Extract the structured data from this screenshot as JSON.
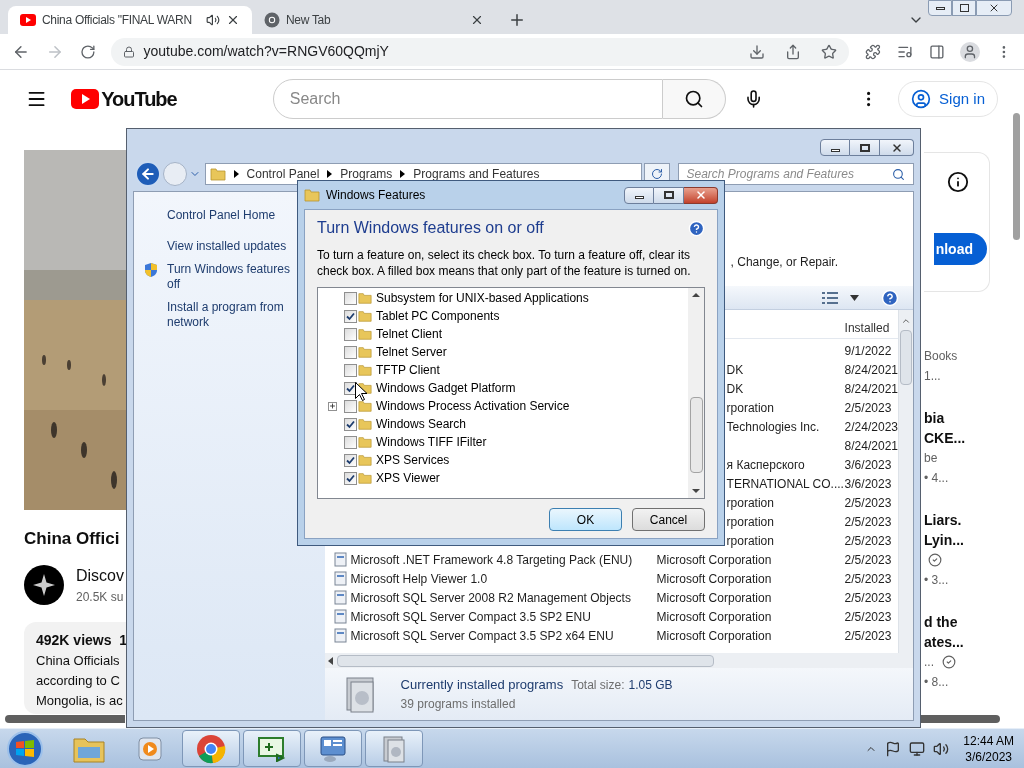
{
  "browser": {
    "tabs": [
      {
        "title": "China Officials \"FINAL WARN",
        "kind": "youtube",
        "audio": true,
        "selected": true
      },
      {
        "title": "New Tab",
        "kind": "chrome",
        "audio": false,
        "selected": false
      }
    ],
    "address": "youtube.com/watch?v=RNGV60QQmjY"
  },
  "youtube": {
    "logo": "YouTube",
    "search_placeholder": "Search",
    "sign_in": "Sign in",
    "video_title": "China Offici",
    "channel": "Discov",
    "subscribers": "20.5K su",
    "views": "492K views  1",
    "description": [
      "China Officials",
      "according to C",
      "Mongolia, is ac"
    ],
    "download_button": "nload",
    "suggestions": [
      [
        {
          "kind": "meta",
          "text": "Books",
          "verified": false
        },
        {
          "kind": "meta",
          "text": "1...",
          "verified": false
        }
      ],
      [
        {
          "kind": "title",
          "text": "bia"
        },
        {
          "kind": "title",
          "text": "CKE..."
        },
        {
          "kind": "meta",
          "text": "be",
          "verified": false
        },
        {
          "kind": "meta",
          "text": "• 4...",
          "verified": false
        }
      ],
      [
        {
          "kind": "title",
          "text": "Liars."
        },
        {
          "kind": "title",
          "text": "Lyin..."
        },
        {
          "kind": "check"
        },
        {
          "kind": "meta",
          "text": "• 3...",
          "verified": false
        }
      ],
      [
        {
          "kind": "title",
          "text": "d the"
        },
        {
          "kind": "title",
          "text": "ates..."
        },
        {
          "kind": "meta",
          "text": "...",
          "verified": true
        },
        {
          "kind": "meta",
          "text": "• 8...",
          "verified": false
        }
      ]
    ]
  },
  "control_panel": {
    "breadcrumb": [
      "Control Panel",
      "Programs",
      "Programs and Features"
    ],
    "search_placeholder": "Search Programs and Features",
    "sidebar": [
      {
        "lines": [
          "Control Panel Home"
        ],
        "shield": false
      },
      {
        "lines": [
          "View installed updates"
        ],
        "shield": false
      },
      {
        "lines": [
          "Turn Windows features",
          "off"
        ],
        "shield": true
      },
      {
        "lines": [
          "Install a program from",
          "network"
        ],
        "shield": false
      }
    ],
    "info_fragment": ", Change, or Repair.",
    "column_header": "Installed",
    "rows": [
      {
        "kind": "covered",
        "installed": "9/1/2022"
      },
      {
        "kind": "covered",
        "publisher": "DK",
        "installed": "8/24/2021"
      },
      {
        "kind": "covered",
        "publisher": "DK",
        "installed": "8/24/2021"
      },
      {
        "kind": "covered",
        "publisher": "rporation",
        "installed": "2/5/2023"
      },
      {
        "kind": "covered",
        "publisher": "Technologies Inc.",
        "installed": "2/24/2023"
      },
      {
        "kind": "covered",
        "installed": "8/24/2021"
      },
      {
        "kind": "covered",
        "publisher": "я Касперского",
        "installed": "3/6/2023"
      },
      {
        "kind": "covered",
        "publisher": "TERNATIONAL CO....",
        "installed": "3/6/2023"
      },
      {
        "kind": "covered",
        "publisher": "rporation",
        "installed": "2/5/2023"
      },
      {
        "kind": "covered",
        "publisher": "rporation",
        "installed": "2/5/2023"
      },
      {
        "kind": "covered",
        "publisher": "rporation",
        "installed": "2/5/2023"
      },
      {
        "kind": "full",
        "name": "Microsoft .NET Framework 4.8 Targeting Pack (ENU)",
        "publisher": "Microsoft Corporation",
        "installed": "2/5/2023"
      },
      {
        "kind": "full",
        "name": "Microsoft Help Viewer 1.0",
        "publisher": "Microsoft Corporation",
        "installed": "2/5/2023"
      },
      {
        "kind": "full",
        "name": "Microsoft SQL Server 2008 R2 Management Objects",
        "publisher": "Microsoft Corporation",
        "installed": "2/5/2023"
      },
      {
        "kind": "full",
        "name": "Microsoft SQL Server Compact 3.5 SP2 ENU",
        "publisher": "Microsoft Corporation",
        "installed": "2/5/2023"
      },
      {
        "kind": "full",
        "name": "Microsoft SQL Server Compact 3.5 SP2 x64 ENU",
        "publisher": "Microsoft Corporation",
        "installed": "2/5/2023"
      }
    ],
    "footer": {
      "title": "Currently installed programs",
      "size_label": "Total size:",
      "size": "1.05 GB",
      "count": "39 programs installed"
    }
  },
  "dialog": {
    "title": "Windows Features",
    "heading": "Turn Windows features on or off",
    "description": "To turn a feature on, select its check box. To turn a feature off, clear its check box. A filled box means that only part of the feature is turned on.",
    "features": [
      {
        "name": "Subsystem for UNIX-based Applications",
        "checked": false,
        "expandable": false
      },
      {
        "name": "Tablet PC Components",
        "checked": true,
        "expandable": false
      },
      {
        "name": "Telnet Client",
        "checked": false,
        "expandable": false
      },
      {
        "name": "Telnet Server",
        "checked": false,
        "expandable": false
      },
      {
        "name": "TFTP Client",
        "checked": false,
        "expandable": false
      },
      {
        "name": "Windows Gadget Platform",
        "checked": true,
        "expandable": false
      },
      {
        "name": "Windows Process Activation Service",
        "checked": false,
        "expandable": true
      },
      {
        "name": "Windows Search",
        "checked": true,
        "expandable": false
      },
      {
        "name": "Windows TIFF IFilter",
        "checked": false,
        "expandable": false
      },
      {
        "name": "XPS Services",
        "checked": true,
        "expandable": false
      },
      {
        "name": "XPS Viewer",
        "checked": true,
        "expandable": false
      }
    ],
    "ok": "OK",
    "cancel": "Cancel"
  },
  "taskbar": {
    "apps": [
      {
        "kind": "explorer",
        "active": false
      },
      {
        "kind": "media",
        "active": false
      },
      {
        "kind": "chrome",
        "active": true
      },
      {
        "kind": "csharp",
        "active": true
      },
      {
        "kind": "control_panel",
        "active": true
      },
      {
        "kind": "programs",
        "active": true
      }
    ],
    "time": "12:44 AM",
    "date": "3/6/2023"
  }
}
